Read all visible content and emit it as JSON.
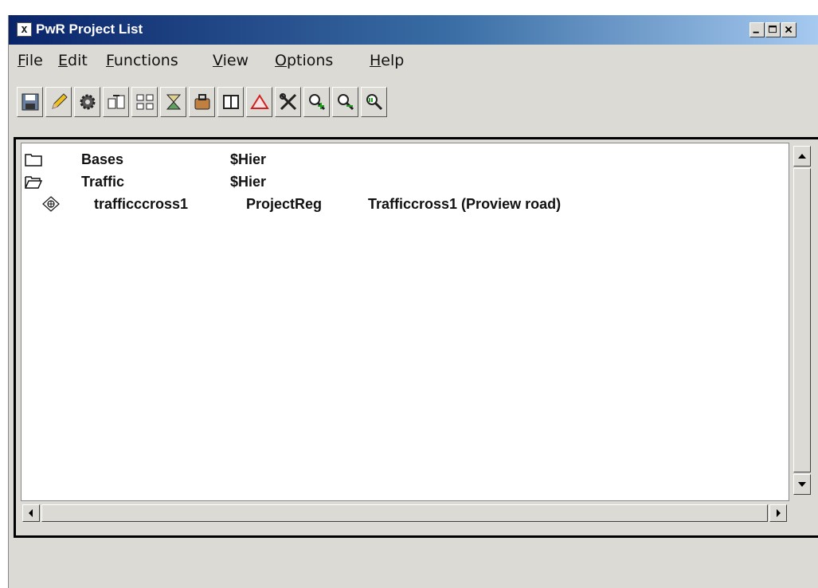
{
  "window": {
    "title": "PwR Project List"
  },
  "menu": [
    {
      "label": "File"
    },
    {
      "label": "Edit"
    },
    {
      "label": "Functions"
    },
    {
      "label": "View"
    },
    {
      "label": "Options"
    },
    {
      "label": "Help"
    }
  ],
  "toolbar": {
    "buttons": [
      {
        "icon": "save-icon"
      },
      {
        "icon": "edit-pencil-icon"
      },
      {
        "icon": "gear-icon"
      },
      {
        "icon": "export-icon"
      },
      {
        "icon": "hierarchy-icon"
      },
      {
        "icon": "flow-icon"
      },
      {
        "icon": "package-icon"
      },
      {
        "icon": "book-icon"
      },
      {
        "icon": "warning-triangle-icon"
      },
      {
        "icon": "tools-icon"
      },
      {
        "icon": "zoom-in-icon"
      },
      {
        "icon": "zoom-out-icon"
      },
      {
        "icon": "zoom-reset-icon"
      }
    ]
  },
  "list": {
    "rows": [
      {
        "icon": "folder-closed-icon",
        "name": "Bases",
        "type": "$Hier"
      },
      {
        "icon": "folder-open-icon",
        "name": "Traffic",
        "type": "$Hier"
      },
      {
        "icon": "project-icon",
        "name": "trafficccross1",
        "type": "ProjectReg",
        "description": "Trafficcross1 (Proview road)"
      }
    ]
  },
  "colors": {
    "titlebar_start": "#0a246a",
    "titlebar_end": "#a6caf0",
    "window_bg": "#dcdad5"
  }
}
